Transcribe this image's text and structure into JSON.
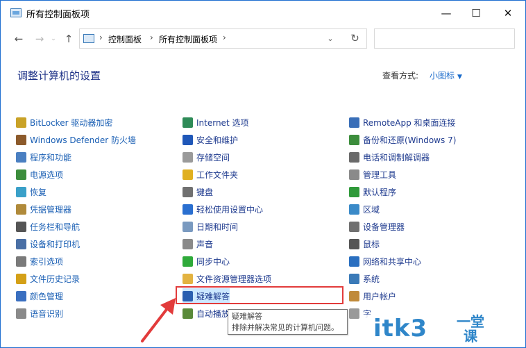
{
  "window": {
    "title": "所有控制面板项",
    "minimize": "—",
    "maximize": "☐",
    "close": "✕"
  },
  "nav": {
    "back": "←",
    "forward": "→",
    "up": "↑",
    "breadcrumb": [
      "控制面板",
      "所有控制面板项"
    ],
    "separator": "›",
    "dropdown": "⌄",
    "refresh": "↻",
    "search_placeholder": ""
  },
  "header": {
    "title": "调整计算机的设置",
    "view_by_label": "查看方式:",
    "view_by_value": "小图标",
    "view_caret": "▼"
  },
  "items": [
    [
      "BitLocker 驱动器加密",
      "Windows Defender 防火墙",
      "程序和功能",
      "电源选项",
      "恢复",
      "凭据管理器",
      "任务栏和导航",
      "设备和打印机",
      "索引选项",
      "文件历史记录",
      "颜色管理",
      "语音识别"
    ],
    [
      "Internet 选项",
      "安全和维护",
      "存储空间",
      "工作文件夹",
      "键盘",
      "轻松使用设置中心",
      "日期和时间",
      "声音",
      "同步中心",
      "文件资源管理器选项",
      "疑难解答",
      "自动播放"
    ],
    [
      "RemoteApp 和桌面连接",
      "备份和还原(Windows 7)",
      "电话和调制解调器",
      "管理工具",
      "默认程序",
      "区域",
      "设备管理器",
      "鼠标",
      "网络和共享中心",
      "系统",
      "用户帐户",
      "字"
    ]
  ],
  "icon_names": [
    [
      "bitlocker-icon",
      "firewall-icon",
      "programs-icon",
      "power-icon",
      "recovery-icon",
      "credential-icon",
      "taskbar-icon",
      "printer-icon",
      "index-icon",
      "file-history-icon",
      "color-icon",
      "speech-icon"
    ],
    [
      "internet-options-icon",
      "security-flag-icon",
      "storage-icon",
      "work-folders-icon",
      "keyboard-icon",
      "ease-of-access-icon",
      "clock-icon",
      "speaker-icon",
      "sync-icon",
      "folder-options-icon",
      "troubleshoot-icon",
      "autoplay-icon"
    ],
    [
      "remoteapp-icon",
      "backup-icon",
      "phone-icon",
      "admin-tools-icon",
      "default-programs-icon",
      "region-icon",
      "device-manager-icon",
      "mouse-icon",
      "network-icon",
      "system-icon",
      "users-icon",
      "font-icon"
    ]
  ],
  "icon_colors": [
    [
      "#c9a227",
      "#8c5a2b",
      "#4a7fc1",
      "#3c8d3c",
      "#3aa0c8",
      "#b08a3a",
      "#555555",
      "#4a6fa5",
      "#7a7a7a",
      "#d4a017",
      "#3a6fc0",
      "#8a8a8a"
    ],
    [
      "#2e8b57",
      "#1f57b8",
      "#9a9a9a",
      "#e0b020",
      "#707070",
      "#2a6fd0",
      "#7a9ac0",
      "#8a8a8a",
      "#2faa3a",
      "#e3b341",
      "#2a5fb0",
      "#5a8a3a"
    ],
    [
      "#3a6fb8",
      "#3c8d3c",
      "#6a6a6a",
      "#8a8a8a",
      "#2f9a3a",
      "#3a8ac8",
      "#707070",
      "#555555",
      "#2a6fc0",
      "#3a7ab8",
      "#c08a3a",
      "#999999"
    ]
  ],
  "tooltip": {
    "title": "疑难解答",
    "description": "排除并解决常见的计算机问题。"
  },
  "watermark": {
    "text": "itk3",
    "side_top": "一堂",
    "side_bottom": "课"
  }
}
